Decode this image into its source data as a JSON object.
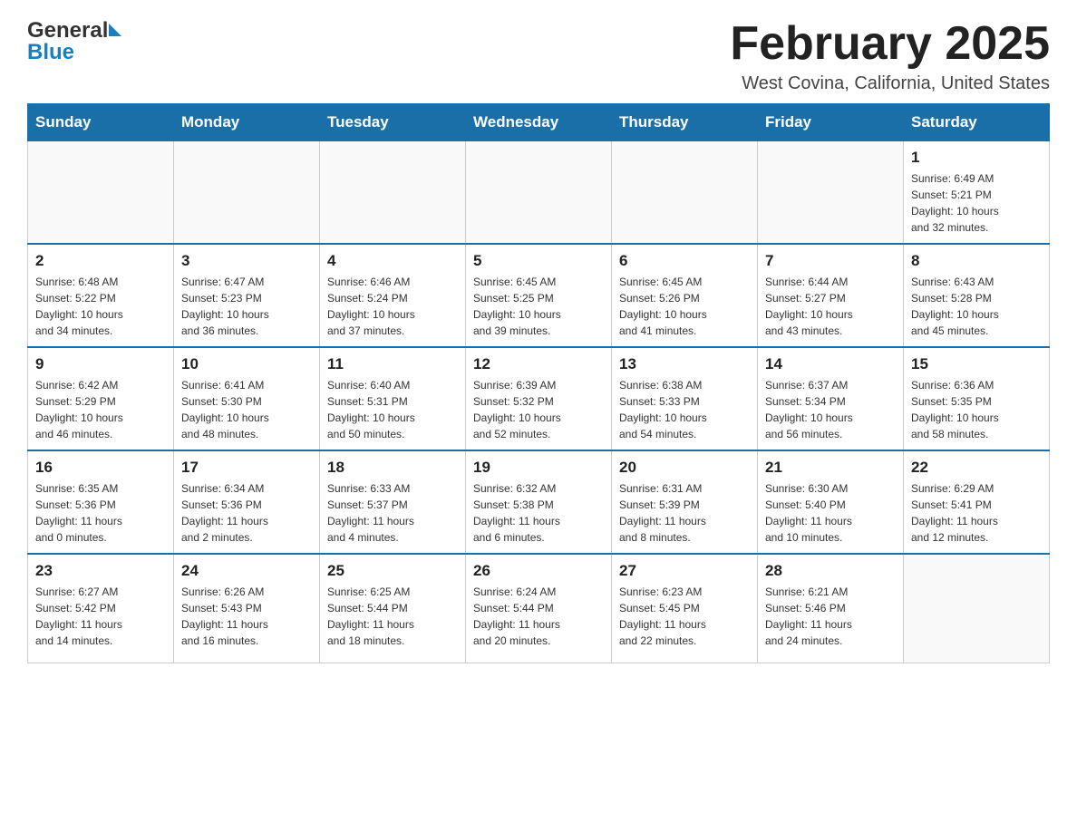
{
  "header": {
    "logo_general": "General",
    "logo_blue": "Blue",
    "month_title": "February 2025",
    "subtitle": "West Covina, California, United States"
  },
  "weekdays": [
    "Sunday",
    "Monday",
    "Tuesday",
    "Wednesday",
    "Thursday",
    "Friday",
    "Saturday"
  ],
  "weeks": [
    [
      {
        "day": "",
        "info": ""
      },
      {
        "day": "",
        "info": ""
      },
      {
        "day": "",
        "info": ""
      },
      {
        "day": "",
        "info": ""
      },
      {
        "day": "",
        "info": ""
      },
      {
        "day": "",
        "info": ""
      },
      {
        "day": "1",
        "info": "Sunrise: 6:49 AM\nSunset: 5:21 PM\nDaylight: 10 hours\nand 32 minutes."
      }
    ],
    [
      {
        "day": "2",
        "info": "Sunrise: 6:48 AM\nSunset: 5:22 PM\nDaylight: 10 hours\nand 34 minutes."
      },
      {
        "day": "3",
        "info": "Sunrise: 6:47 AM\nSunset: 5:23 PM\nDaylight: 10 hours\nand 36 minutes."
      },
      {
        "day": "4",
        "info": "Sunrise: 6:46 AM\nSunset: 5:24 PM\nDaylight: 10 hours\nand 37 minutes."
      },
      {
        "day": "5",
        "info": "Sunrise: 6:45 AM\nSunset: 5:25 PM\nDaylight: 10 hours\nand 39 minutes."
      },
      {
        "day": "6",
        "info": "Sunrise: 6:45 AM\nSunset: 5:26 PM\nDaylight: 10 hours\nand 41 minutes."
      },
      {
        "day": "7",
        "info": "Sunrise: 6:44 AM\nSunset: 5:27 PM\nDaylight: 10 hours\nand 43 minutes."
      },
      {
        "day": "8",
        "info": "Sunrise: 6:43 AM\nSunset: 5:28 PM\nDaylight: 10 hours\nand 45 minutes."
      }
    ],
    [
      {
        "day": "9",
        "info": "Sunrise: 6:42 AM\nSunset: 5:29 PM\nDaylight: 10 hours\nand 46 minutes."
      },
      {
        "day": "10",
        "info": "Sunrise: 6:41 AM\nSunset: 5:30 PM\nDaylight: 10 hours\nand 48 minutes."
      },
      {
        "day": "11",
        "info": "Sunrise: 6:40 AM\nSunset: 5:31 PM\nDaylight: 10 hours\nand 50 minutes."
      },
      {
        "day": "12",
        "info": "Sunrise: 6:39 AM\nSunset: 5:32 PM\nDaylight: 10 hours\nand 52 minutes."
      },
      {
        "day": "13",
        "info": "Sunrise: 6:38 AM\nSunset: 5:33 PM\nDaylight: 10 hours\nand 54 minutes."
      },
      {
        "day": "14",
        "info": "Sunrise: 6:37 AM\nSunset: 5:34 PM\nDaylight: 10 hours\nand 56 minutes."
      },
      {
        "day": "15",
        "info": "Sunrise: 6:36 AM\nSunset: 5:35 PM\nDaylight: 10 hours\nand 58 minutes."
      }
    ],
    [
      {
        "day": "16",
        "info": "Sunrise: 6:35 AM\nSunset: 5:36 PM\nDaylight: 11 hours\nand 0 minutes."
      },
      {
        "day": "17",
        "info": "Sunrise: 6:34 AM\nSunset: 5:36 PM\nDaylight: 11 hours\nand 2 minutes."
      },
      {
        "day": "18",
        "info": "Sunrise: 6:33 AM\nSunset: 5:37 PM\nDaylight: 11 hours\nand 4 minutes."
      },
      {
        "day": "19",
        "info": "Sunrise: 6:32 AM\nSunset: 5:38 PM\nDaylight: 11 hours\nand 6 minutes."
      },
      {
        "day": "20",
        "info": "Sunrise: 6:31 AM\nSunset: 5:39 PM\nDaylight: 11 hours\nand 8 minutes."
      },
      {
        "day": "21",
        "info": "Sunrise: 6:30 AM\nSunset: 5:40 PM\nDaylight: 11 hours\nand 10 minutes."
      },
      {
        "day": "22",
        "info": "Sunrise: 6:29 AM\nSunset: 5:41 PM\nDaylight: 11 hours\nand 12 minutes."
      }
    ],
    [
      {
        "day": "23",
        "info": "Sunrise: 6:27 AM\nSunset: 5:42 PM\nDaylight: 11 hours\nand 14 minutes."
      },
      {
        "day": "24",
        "info": "Sunrise: 6:26 AM\nSunset: 5:43 PM\nDaylight: 11 hours\nand 16 minutes."
      },
      {
        "day": "25",
        "info": "Sunrise: 6:25 AM\nSunset: 5:44 PM\nDaylight: 11 hours\nand 18 minutes."
      },
      {
        "day": "26",
        "info": "Sunrise: 6:24 AM\nSunset: 5:44 PM\nDaylight: 11 hours\nand 20 minutes."
      },
      {
        "day": "27",
        "info": "Sunrise: 6:23 AM\nSunset: 5:45 PM\nDaylight: 11 hours\nand 22 minutes."
      },
      {
        "day": "28",
        "info": "Sunrise: 6:21 AM\nSunset: 5:46 PM\nDaylight: 11 hours\nand 24 minutes."
      },
      {
        "day": "",
        "info": ""
      }
    ]
  ]
}
